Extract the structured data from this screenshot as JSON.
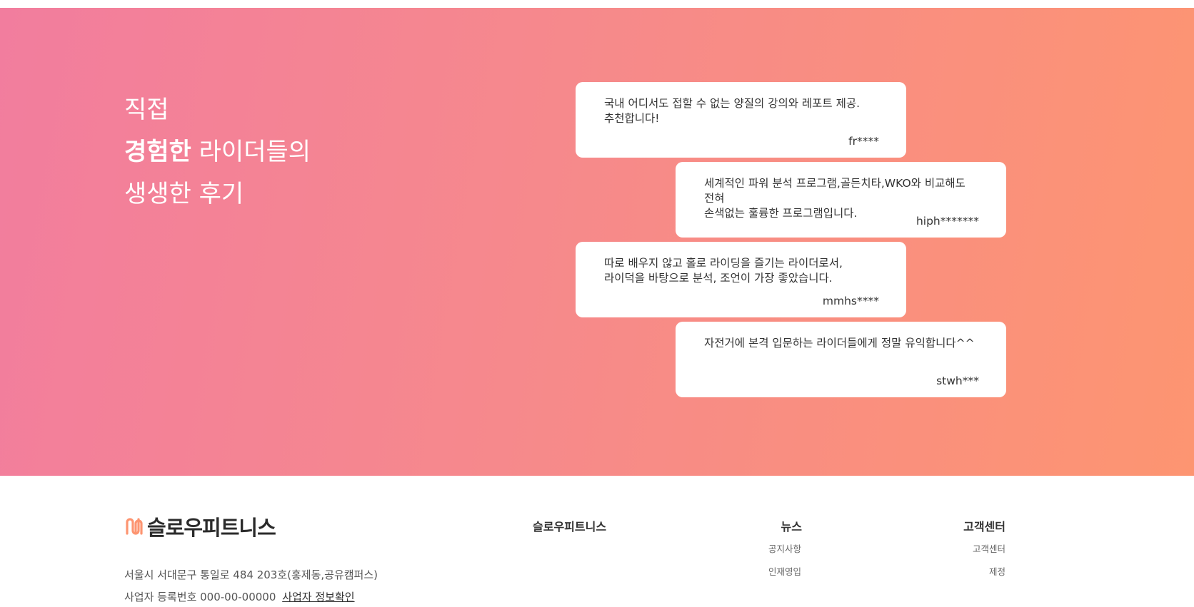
{
  "hero": {
    "heading": {
      "line1": "직접",
      "line2_bold": "경험한",
      "line2_rest": " 라이더들의",
      "line3": "생생한 후기"
    },
    "reviews": [
      {
        "text": "국내 어디서도 접할 수 없는 양질의 강의와 레포트 제공.\n추천합니다!",
        "author": "fr****"
      },
      {
        "text": "세계적인 파워 분석 프로그램,골든치타,WKO와 비교해도 전혀\n손색없는 훌륭한 프로그램입니다.",
        "author": "hiph*******"
      },
      {
        "text": "따로 배우지 않고 홀로 라이딩을 즐기는 라이더로서,\n라이덕을 바탕으로 분석, 조언이 가장 좋았습니다.",
        "author": "mmhs****"
      },
      {
        "text": "자전거에 본격 입문하는 라이더들에게 정말 유익합니다^^",
        "author": "stwh***"
      }
    ]
  },
  "footer": {
    "logo_text": "슬로우피트니스",
    "address": "서울시 서대문구 통일로 484 203호(홍제동,공유캠퍼스)",
    "biz_number": "사업자 등록번호 000-00-00000",
    "biz_link": "사업자 정보확인",
    "columns": {
      "brand": {
        "title": "슬로우피트니스"
      },
      "news": {
        "title": "뉴스",
        "links": [
          "공지사항",
          "인재영입"
        ]
      },
      "support": {
        "title": "고객센터",
        "links": [
          "고객센터",
          "제정"
        ]
      }
    }
  },
  "colors": {
    "gradient_start": "#f27d9e",
    "gradient_end": "#fd9571",
    "logo_accent": "#fd9571"
  }
}
